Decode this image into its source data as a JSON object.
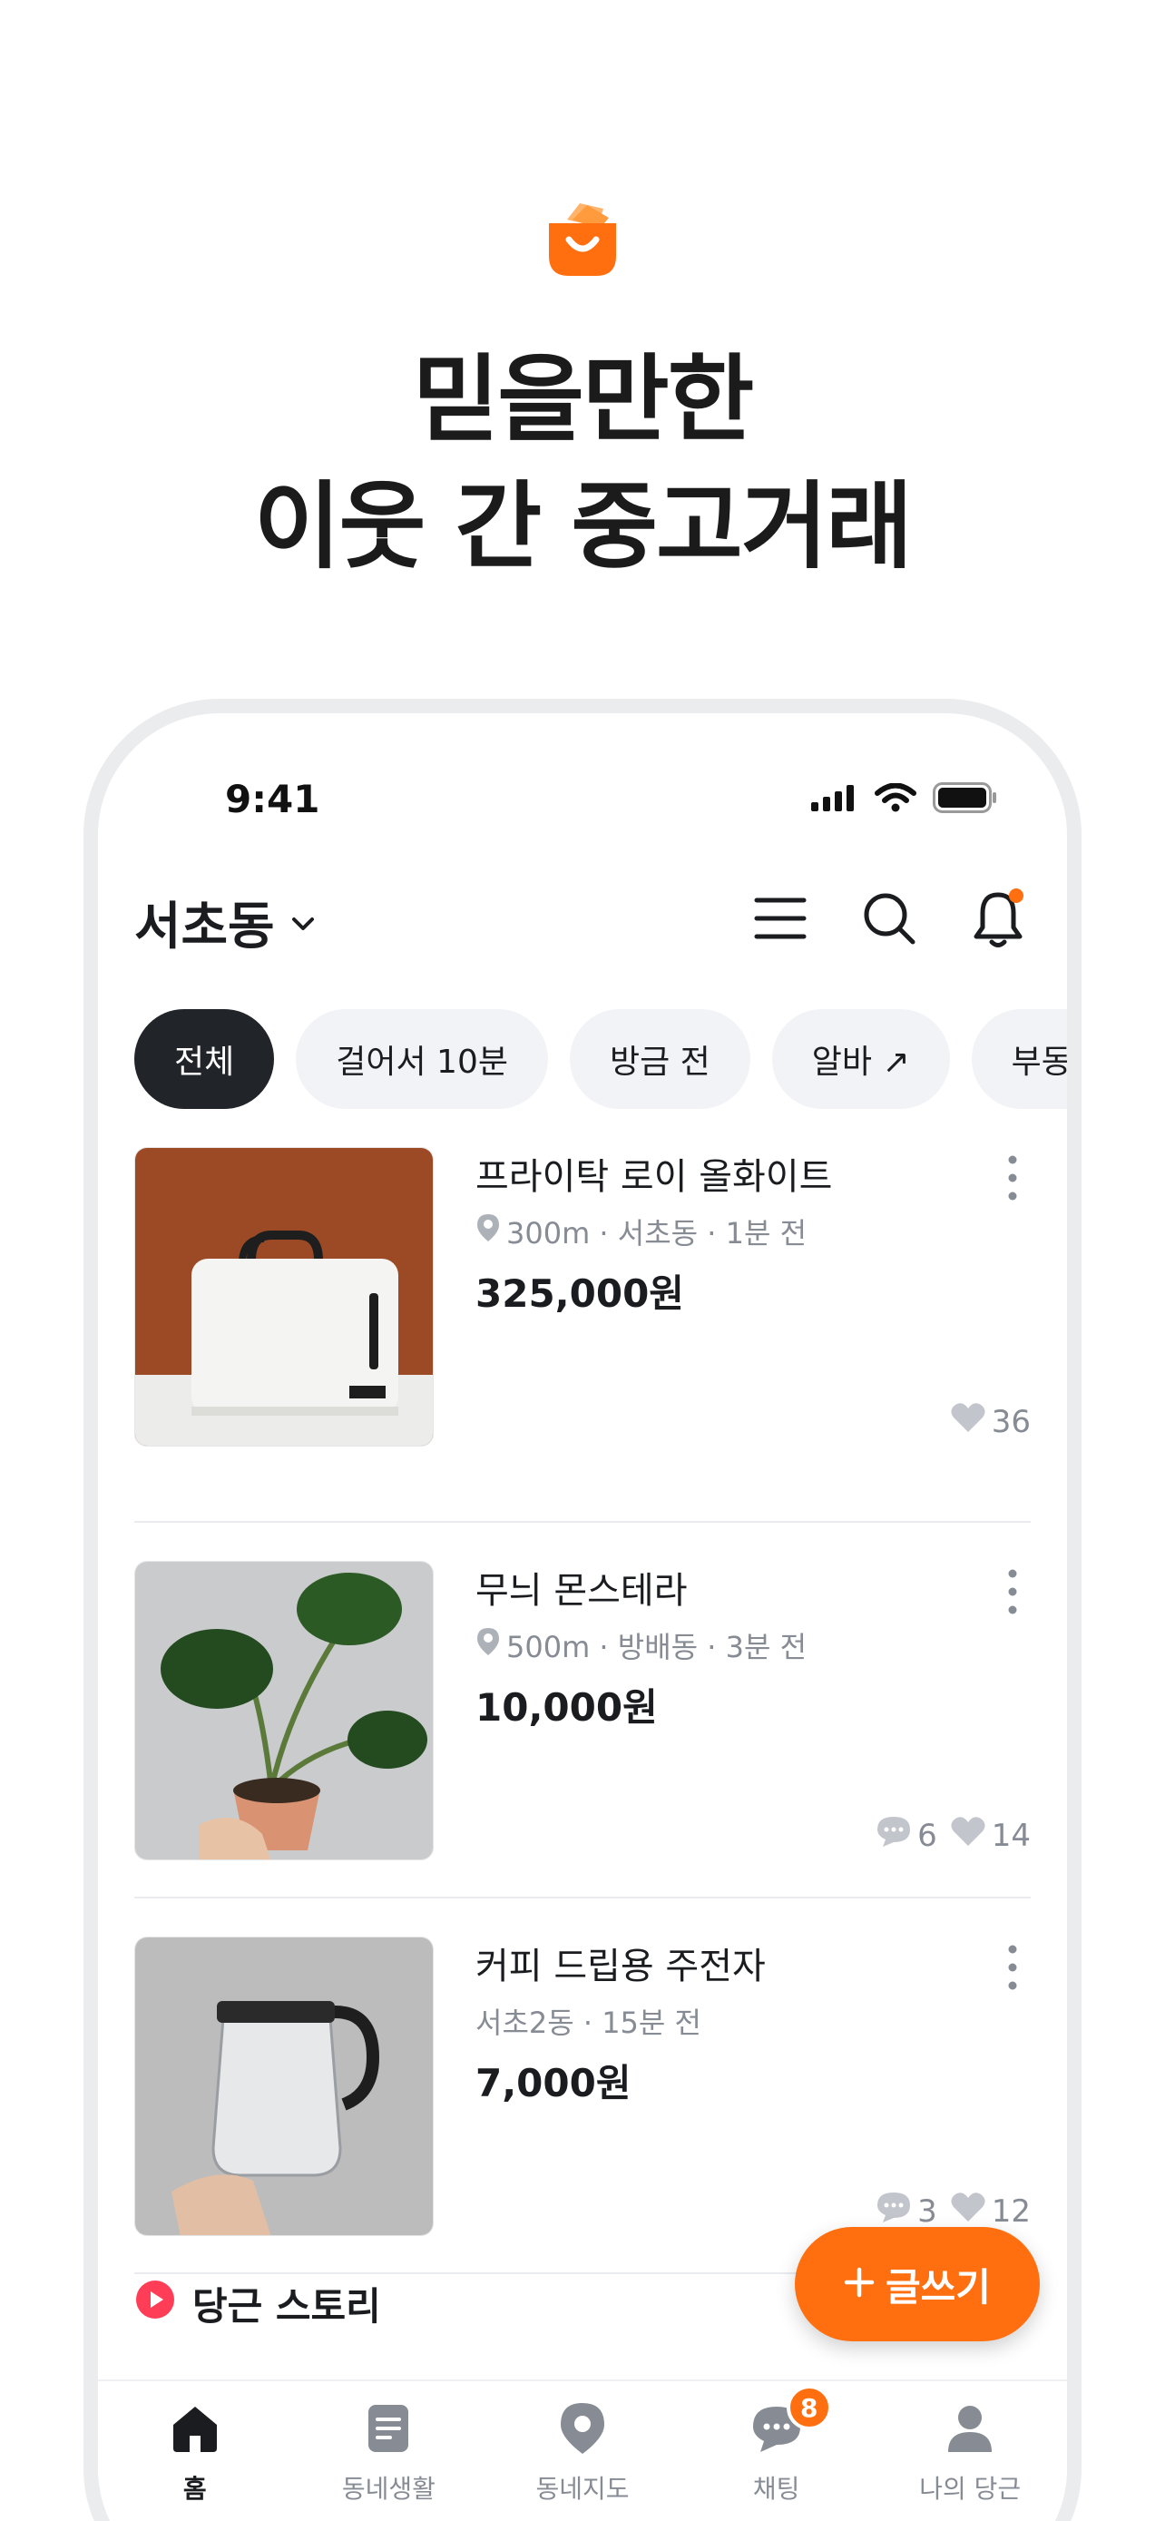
{
  "promo": {
    "headline_line1": "믿을만한",
    "headline_line2": "이웃 간 중고거래",
    "brand_color": "#ff6f0f"
  },
  "status_bar": {
    "time": "9:41"
  },
  "header": {
    "location": "서초동",
    "icons": [
      "menu-icon",
      "search-icon",
      "bell-icon"
    ]
  },
  "filters": [
    {
      "label": "전체",
      "active": true
    },
    {
      "label": "걸어서 10분",
      "active": false
    },
    {
      "label": "방금 전",
      "active": false
    },
    {
      "label": "알바 ↗",
      "active": false
    },
    {
      "label": "부동산",
      "active": false
    }
  ],
  "listings": [
    {
      "title": "프라이탁 로이 올화이트",
      "meta": "300m · 서초동 · 1분 전",
      "has_location_icon": true,
      "price": "325,000원",
      "chats": "",
      "likes": "36"
    },
    {
      "title": "무늬 몬스테라",
      "meta": "500m · 방배동 · 3분 전",
      "has_location_icon": true,
      "price": "10,000원",
      "chats": "6",
      "likes": "14"
    },
    {
      "title": "커피 드립용 주전자",
      "meta": "서초2동 · 15분 전",
      "has_location_icon": false,
      "price": "7,000원",
      "chats": "3",
      "likes": "12"
    }
  ],
  "story": {
    "label": "당근 스토리"
  },
  "fab": {
    "label": "글쓰기"
  },
  "tabbar": [
    {
      "label": "홈",
      "icon": "home-icon",
      "active": true
    },
    {
      "label": "동네생활",
      "icon": "document-icon",
      "active": false
    },
    {
      "label": "동네지도",
      "icon": "map-pin-icon",
      "active": false
    },
    {
      "label": "채팅",
      "icon": "chat-icon",
      "active": false,
      "badge": "8"
    },
    {
      "label": "나의 당근",
      "icon": "person-icon",
      "active": false
    }
  ]
}
